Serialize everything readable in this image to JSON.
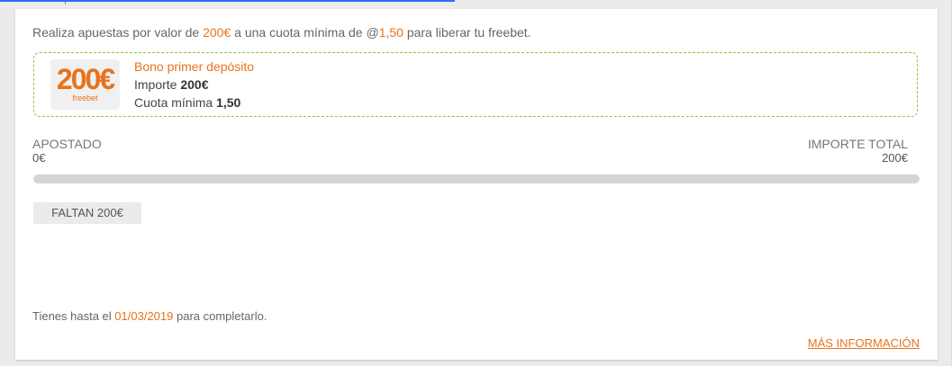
{
  "intro": {
    "prefix": "Realiza apuestas por valor de ",
    "amount": "200€",
    "middle": " a una cuota mínima de @",
    "odds": "1,50",
    "suffix": " para liberar tu freebet."
  },
  "bonus": {
    "logo_amount": "200€",
    "logo_label": "freebet",
    "title": "Bono primer depósito",
    "amount_label": "Importe ",
    "amount_value": "200€",
    "odds_label": "Cuota mínima ",
    "odds_value": "1,50"
  },
  "progress": {
    "wagered_label": "APOSTADO",
    "wagered_value": "0€",
    "total_label": "IMPORTE TOTAL",
    "total_value": "200€",
    "fraction": 0
  },
  "remaining": {
    "label": "FALTAN 200€"
  },
  "deadline": {
    "prefix": "Tienes hasta el ",
    "date": "01/03/2019",
    "suffix": " para completarlo."
  },
  "more_info": {
    "label": "MÁS INFORMACIÓN"
  },
  "colors": {
    "accent": "#e8731c",
    "dashed_border": "#8cc640",
    "loader": "#2a6ef0"
  }
}
